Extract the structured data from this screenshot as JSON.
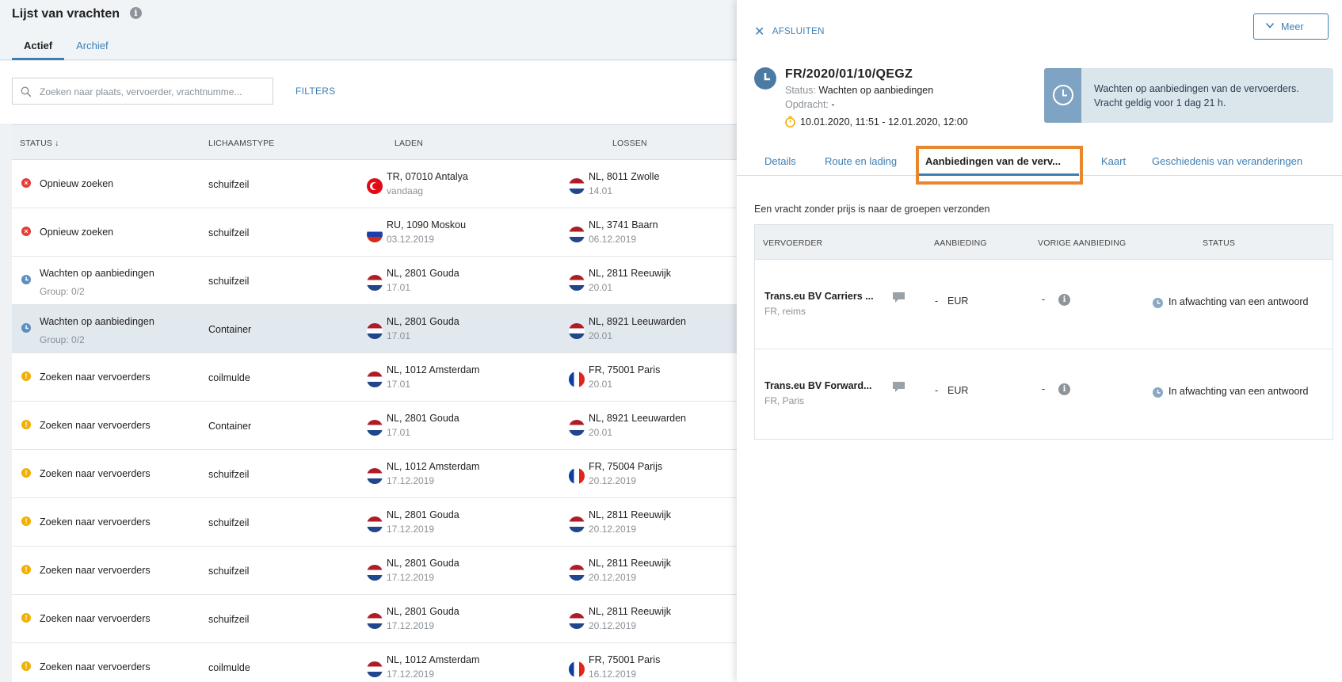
{
  "list": {
    "title": "Lijst van vrachten",
    "tabs": [
      {
        "label": "Actief"
      },
      {
        "label": "Archief"
      }
    ],
    "search_placeholder": "Zoeken naar plaats, vervoerder, vrachtnumme...",
    "filters_label": "FILTERS",
    "columns": {
      "status": "STATUS ↓",
      "body": "LICHAAMSTYPE",
      "load": "LADEN",
      "unload": "LOSSEN"
    },
    "rows": [
      {
        "status": "Opnieuw zoeken",
        "sub": "",
        "icon": "error-icon",
        "body": "schuifzeil",
        "load_flag": "tr",
        "load": "TR, 07010 Antalya",
        "load_date": "vandaag",
        "unload_flag": "nl",
        "unload": "NL, 8011 Zwolle",
        "unload_date": "14.01"
      },
      {
        "status": "Opnieuw zoeken",
        "sub": "",
        "icon": "error-icon",
        "body": "schuifzeil",
        "load_flag": "ru",
        "load": "RU, 1090 Moskou",
        "load_date": "03.12.2019",
        "unload_flag": "nl",
        "unload": "NL, 3741 Baarn",
        "unload_date": "06.12.2019"
      },
      {
        "status": "Wachten op aanbiedingen",
        "sub": "Group: 0/2",
        "icon": "clock-icon",
        "body": "schuifzeil",
        "load_flag": "nl",
        "load": "NL, 2801 Gouda",
        "load_date": "17.01",
        "unload_flag": "nl",
        "unload": "NL, 2811 Reeuwijk",
        "unload_date": "20.01"
      },
      {
        "status": "Wachten op aanbiedingen",
        "sub": "Group: 0/2",
        "icon": "clock-icon",
        "body": "Container",
        "load_flag": "nl",
        "load": "NL, 2801 Gouda",
        "load_date": "17.01",
        "unload_flag": "nl",
        "unload": "NL, 8921 Leeuwarden",
        "unload_date": "20.01",
        "selected": true
      },
      {
        "status": "Zoeken naar vervoerders",
        "sub": "",
        "icon": "warning-icon",
        "body": "coilmulde",
        "load_flag": "nl",
        "load": "NL, 1012 Amsterdam",
        "load_date": "17.01",
        "unload_flag": "fr",
        "unload": "FR, 75001 Paris",
        "unload_date": "20.01"
      },
      {
        "status": "Zoeken naar vervoerders",
        "sub": "",
        "icon": "warning-icon",
        "body": "Container",
        "load_flag": "nl",
        "load": "NL, 2801 Gouda",
        "load_date": "17.01",
        "unload_flag": "nl",
        "unload": "NL, 8921 Leeuwarden",
        "unload_date": "20.01"
      },
      {
        "status": "Zoeken naar vervoerders",
        "sub": "",
        "icon": "warning-icon",
        "body": "schuifzeil",
        "load_flag": "nl",
        "load": "NL, 1012 Amsterdam",
        "load_date": "17.12.2019",
        "unload_flag": "fr",
        "unload": "FR, 75004 Parijs",
        "unload_date": "20.12.2019"
      },
      {
        "status": "Zoeken naar vervoerders",
        "sub": "",
        "icon": "warning-icon",
        "body": "schuifzeil",
        "load_flag": "nl",
        "load": "NL, 2801 Gouda",
        "load_date": "17.12.2019",
        "unload_flag": "nl",
        "unload": "NL, 2811 Reeuwijk",
        "unload_date": "20.12.2019"
      },
      {
        "status": "Zoeken naar vervoerders",
        "sub": "",
        "icon": "warning-icon",
        "body": "schuifzeil",
        "load_flag": "nl",
        "load": "NL, 2801 Gouda",
        "load_date": "17.12.2019",
        "unload_flag": "nl",
        "unload": "NL, 2811 Reeuwijk",
        "unload_date": "20.12.2019"
      },
      {
        "status": "Zoeken naar vervoerders",
        "sub": "",
        "icon": "warning-icon",
        "body": "schuifzeil",
        "load_flag": "nl",
        "load": "NL, 2801 Gouda",
        "load_date": "17.12.2019",
        "unload_flag": "nl",
        "unload": "NL, 2811 Reeuwijk",
        "unload_date": "20.12.2019"
      },
      {
        "status": "Zoeken naar vervoerders",
        "sub": "",
        "icon": "warning-icon",
        "body": "coilmulde",
        "load_flag": "nl",
        "load": "NL, 1012 Amsterdam",
        "load_date": "17.12.2019",
        "unload_flag": "fr",
        "unload": "FR, 75001 Paris",
        "unload_date": "16.12.2019"
      }
    ]
  },
  "panel": {
    "close_label": "AFSLUITEN",
    "more_label": "Meer",
    "reference": "FR/2020/01/10/QEGZ",
    "status_key": "Status:",
    "status_value": "Wachten op aanbiedingen",
    "order_key": "Opdracht:",
    "order_value": "-",
    "period": "10.01.2020, 11:51 - 12.01.2020, 12:00",
    "notice_line1": "Wachten op aanbiedingen van de vervoerders.",
    "notice_line2": "Vracht geldig voor 1 dag 21 h.",
    "tabs": [
      {
        "label": "Details"
      },
      {
        "label": "Route en lading"
      },
      {
        "label": "Aanbiedingen van de verv..."
      },
      {
        "label": "Kaart"
      },
      {
        "label": "Geschiedenis van veranderingen"
      }
    ],
    "active_tab": "Aanbiedingen van de verv...",
    "message": "Een vracht zonder prijs is naar de groepen verzonden",
    "offers_columns": {
      "carrier": "VERVOERDER",
      "offer": "AANBIEDING",
      "previous": "VORIGE AANBIEDING",
      "status": "STATUS"
    },
    "offers": [
      {
        "carrier": "Trans.eu BV Carriers ...",
        "location": "FR, reims",
        "offer": "-",
        "currency": "EUR",
        "previous": "-",
        "status": "In afwachting van een antwoord"
      },
      {
        "carrier": "Trans.eu BV Forward...",
        "location": "FR, Paris",
        "offer": "-",
        "currency": "EUR",
        "previous": "-",
        "status": "In afwachting van een antwoord"
      }
    ]
  },
  "colors": {
    "accent": "#3d7fb3",
    "highlight": "#e9872e",
    "error": "#e2403a",
    "warning": "#f2b000",
    "pending": "#5c8fbd"
  }
}
